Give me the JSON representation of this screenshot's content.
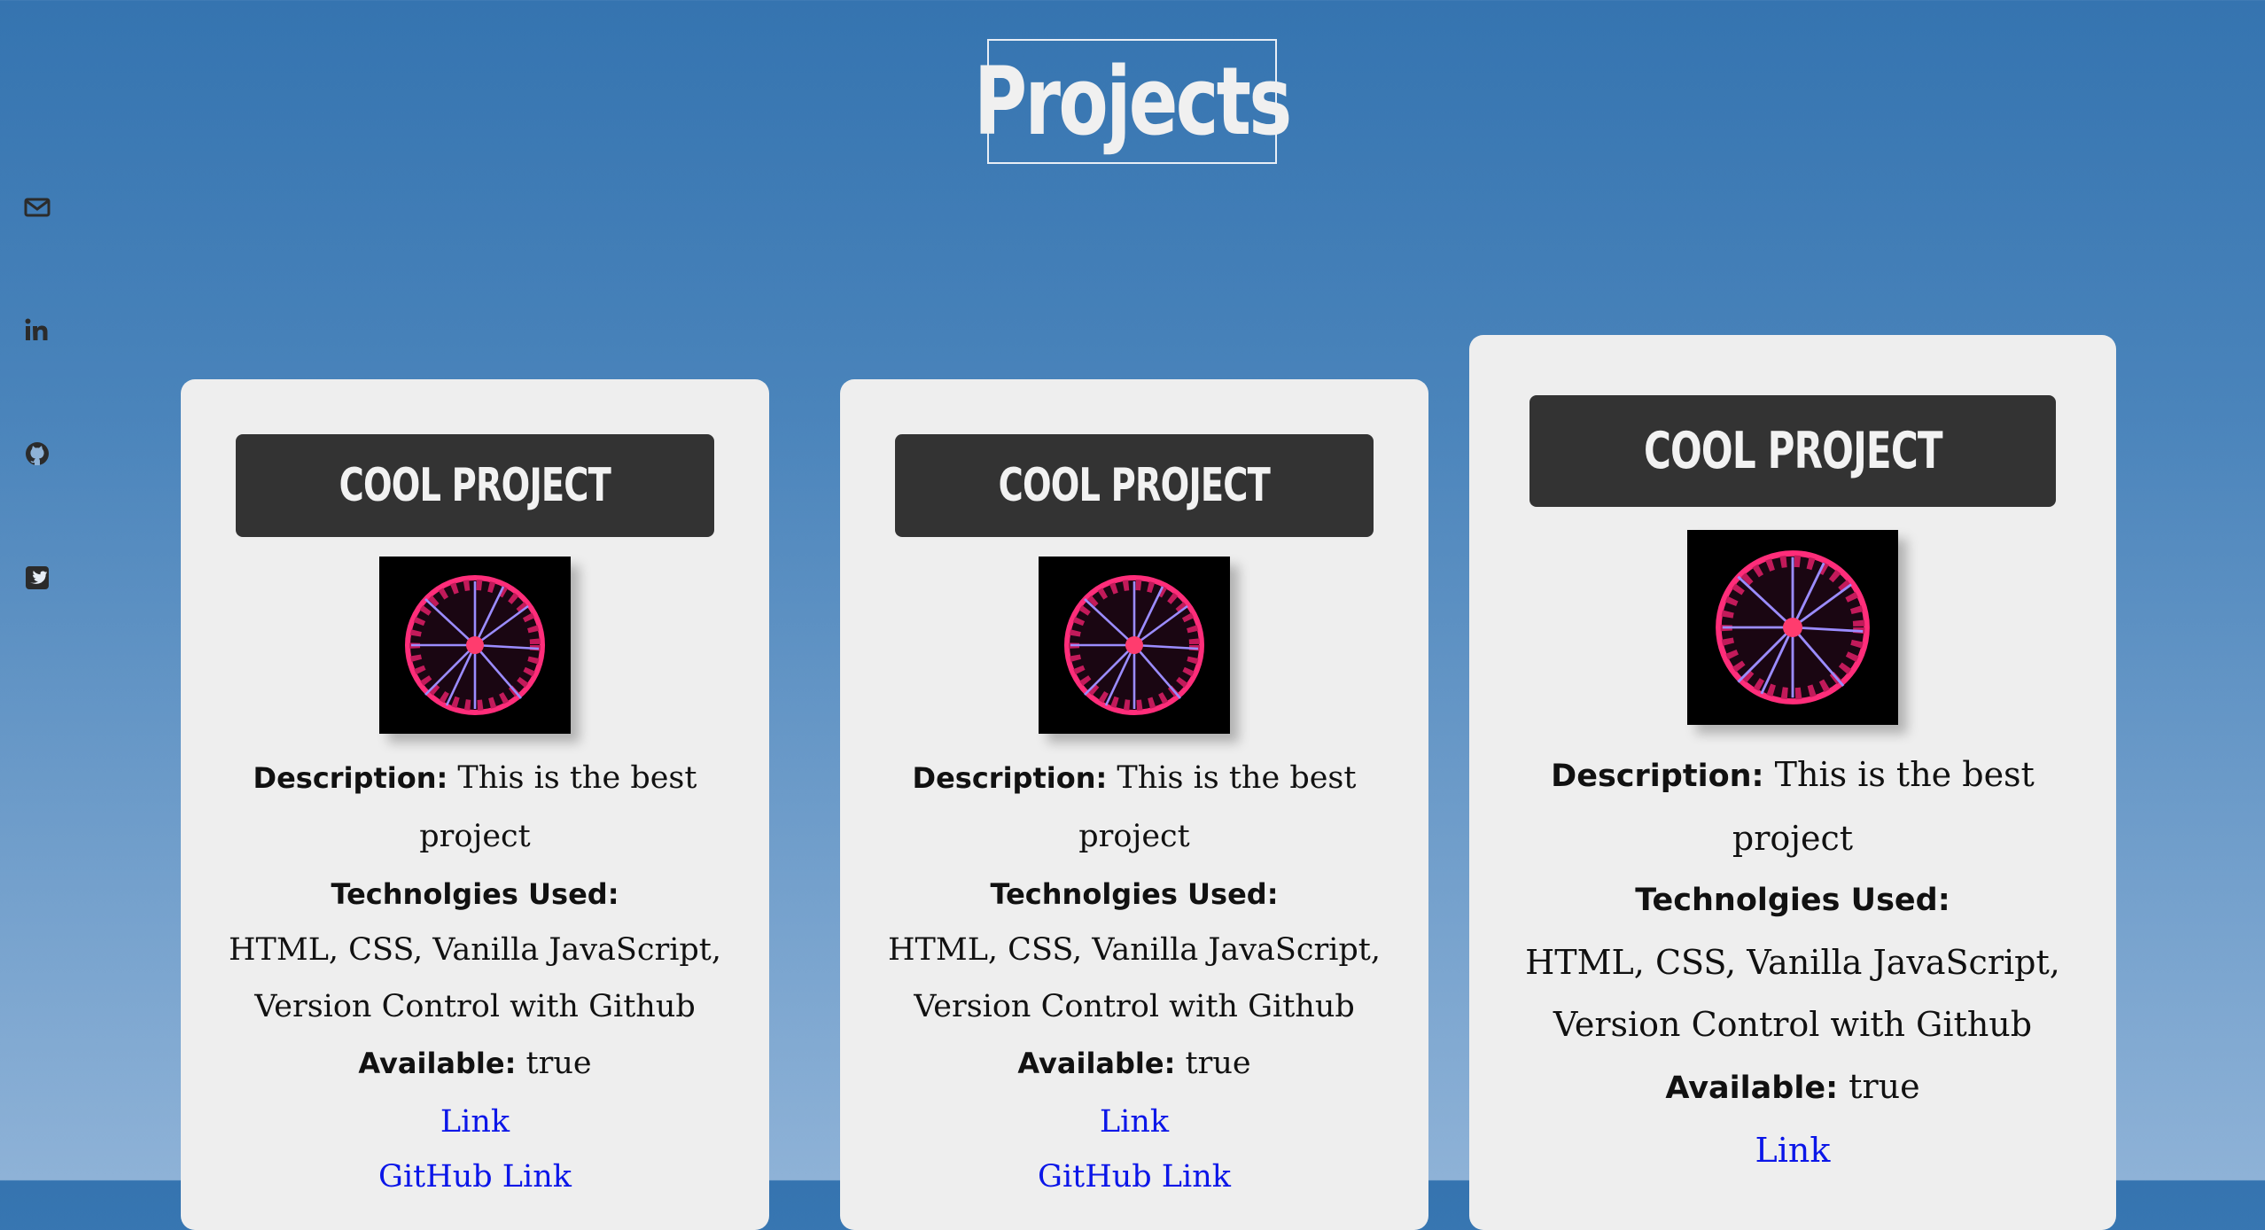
{
  "page": {
    "title": "Projects"
  },
  "social": [
    {
      "name": "email-icon"
    },
    {
      "name": "linkedin-icon"
    },
    {
      "name": "github-icon"
    },
    {
      "name": "twitter-icon"
    }
  ],
  "colors": {
    "card_bg": "#eeeeee",
    "header_bg": "#333333",
    "link": "#0b16e8"
  },
  "projects": [
    {
      "title": "COOL PROJECT",
      "description_label": "Description:",
      "description_line1": "This is the best",
      "description_line2": "project",
      "tech_label": "Technolgies Used:",
      "tech_line1": "HTML, CSS, Vanilla JavaScript,",
      "tech_line2": "Version Control with Github",
      "available_label": "Available:",
      "available_value": "true",
      "link": "Link",
      "github_link": "GitHub Link"
    },
    {
      "title": "COOL PROJECT",
      "description_label": "Description:",
      "description_line1": "This is the best",
      "description_line2": "project",
      "tech_label": "Technolgies Used:",
      "tech_line1": "HTML, CSS, Vanilla JavaScript,",
      "tech_line2": "Version Control with Github",
      "available_label": "Available:",
      "available_value": "true",
      "link": "Link",
      "github_link": "GitHub Link"
    },
    {
      "title": "COOL PROJECT",
      "description_label": "Description:",
      "description_line1": "This is the best",
      "description_line2": "project",
      "tech_label": "Technolgies Used:",
      "tech_line1": "HTML, CSS, Vanilla JavaScript,",
      "tech_line2": "Version Control with Github",
      "available_label": "Available:",
      "available_value": "true",
      "link": "Link"
    }
  ]
}
